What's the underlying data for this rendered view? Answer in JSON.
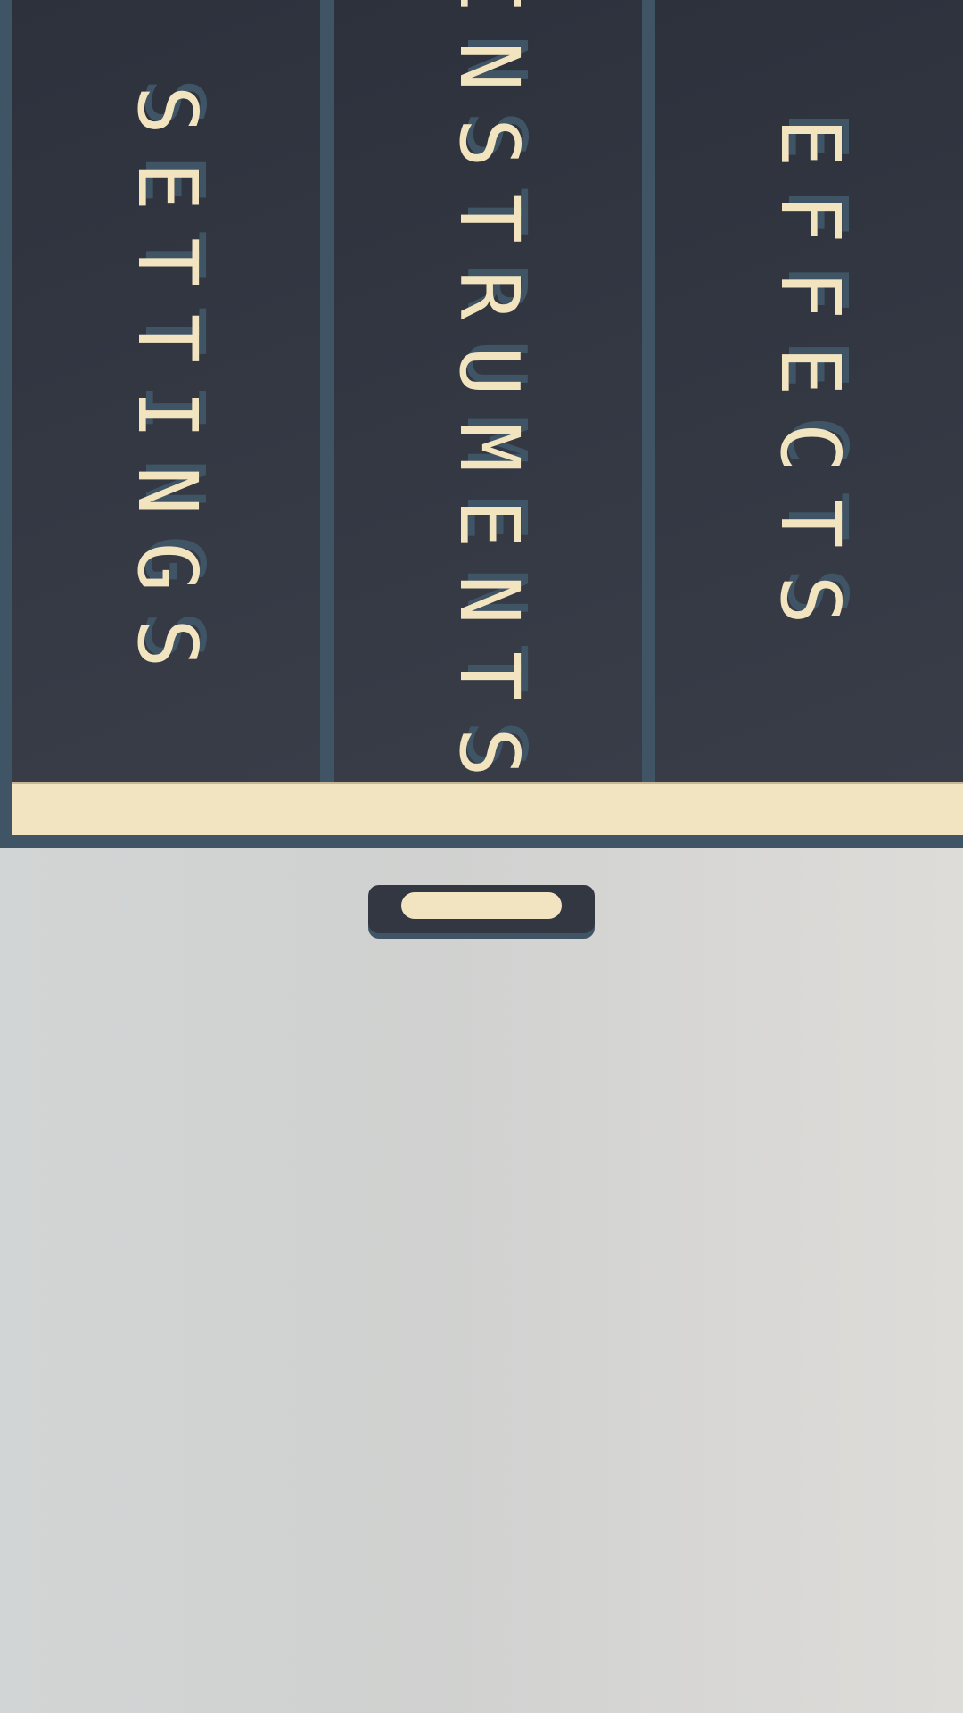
{
  "tabs": [
    {
      "id": "settings",
      "label": "SETTINGS"
    },
    {
      "id": "instruments",
      "label": "INSTRUMENTS"
    },
    {
      "id": "effects",
      "label": "EFFECTS"
    }
  ],
  "colors": {
    "tab_background": "#333742",
    "frame_blue": "#3f5566",
    "cream": "#f2e4c1",
    "lower_background": "#d4d6d5"
  },
  "drag_handle": {
    "icon": "drag-handle-icon"
  }
}
